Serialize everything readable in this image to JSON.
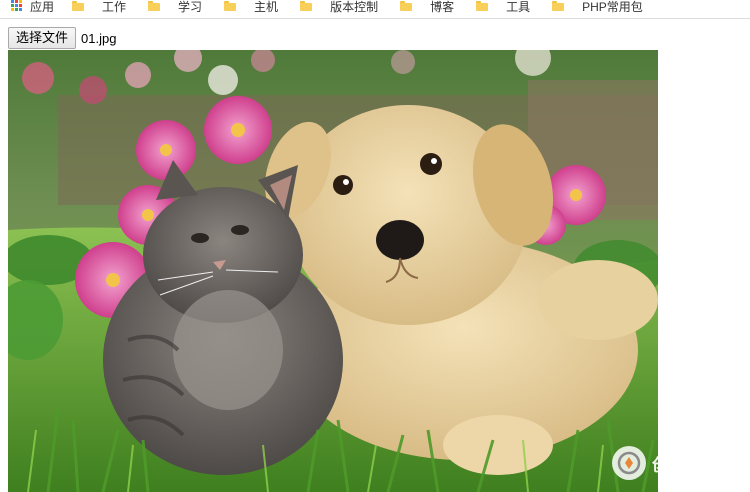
{
  "bookmarks": {
    "apps_label": "应用",
    "items": [
      {
        "label": "工作"
      },
      {
        "label": "学习"
      },
      {
        "label": "主机"
      },
      {
        "label": "版本控制"
      },
      {
        "label": "博客"
      },
      {
        "label": "工具"
      },
      {
        "label": "PHP常用包"
      }
    ]
  },
  "file_input": {
    "button_label": "选择文件",
    "file_name": "01.jpg"
  },
  "preview": {
    "alt": "Puppy and kitten sitting in grass with pink flowers"
  },
  "watermark": {
    "text": "创新互联"
  },
  "colors": {
    "folder": "#f8cf58",
    "grass": "#5a9a2a",
    "puppy": "#e6cf9c",
    "kitten": "#6e6a66",
    "flower": "#d9489a"
  }
}
